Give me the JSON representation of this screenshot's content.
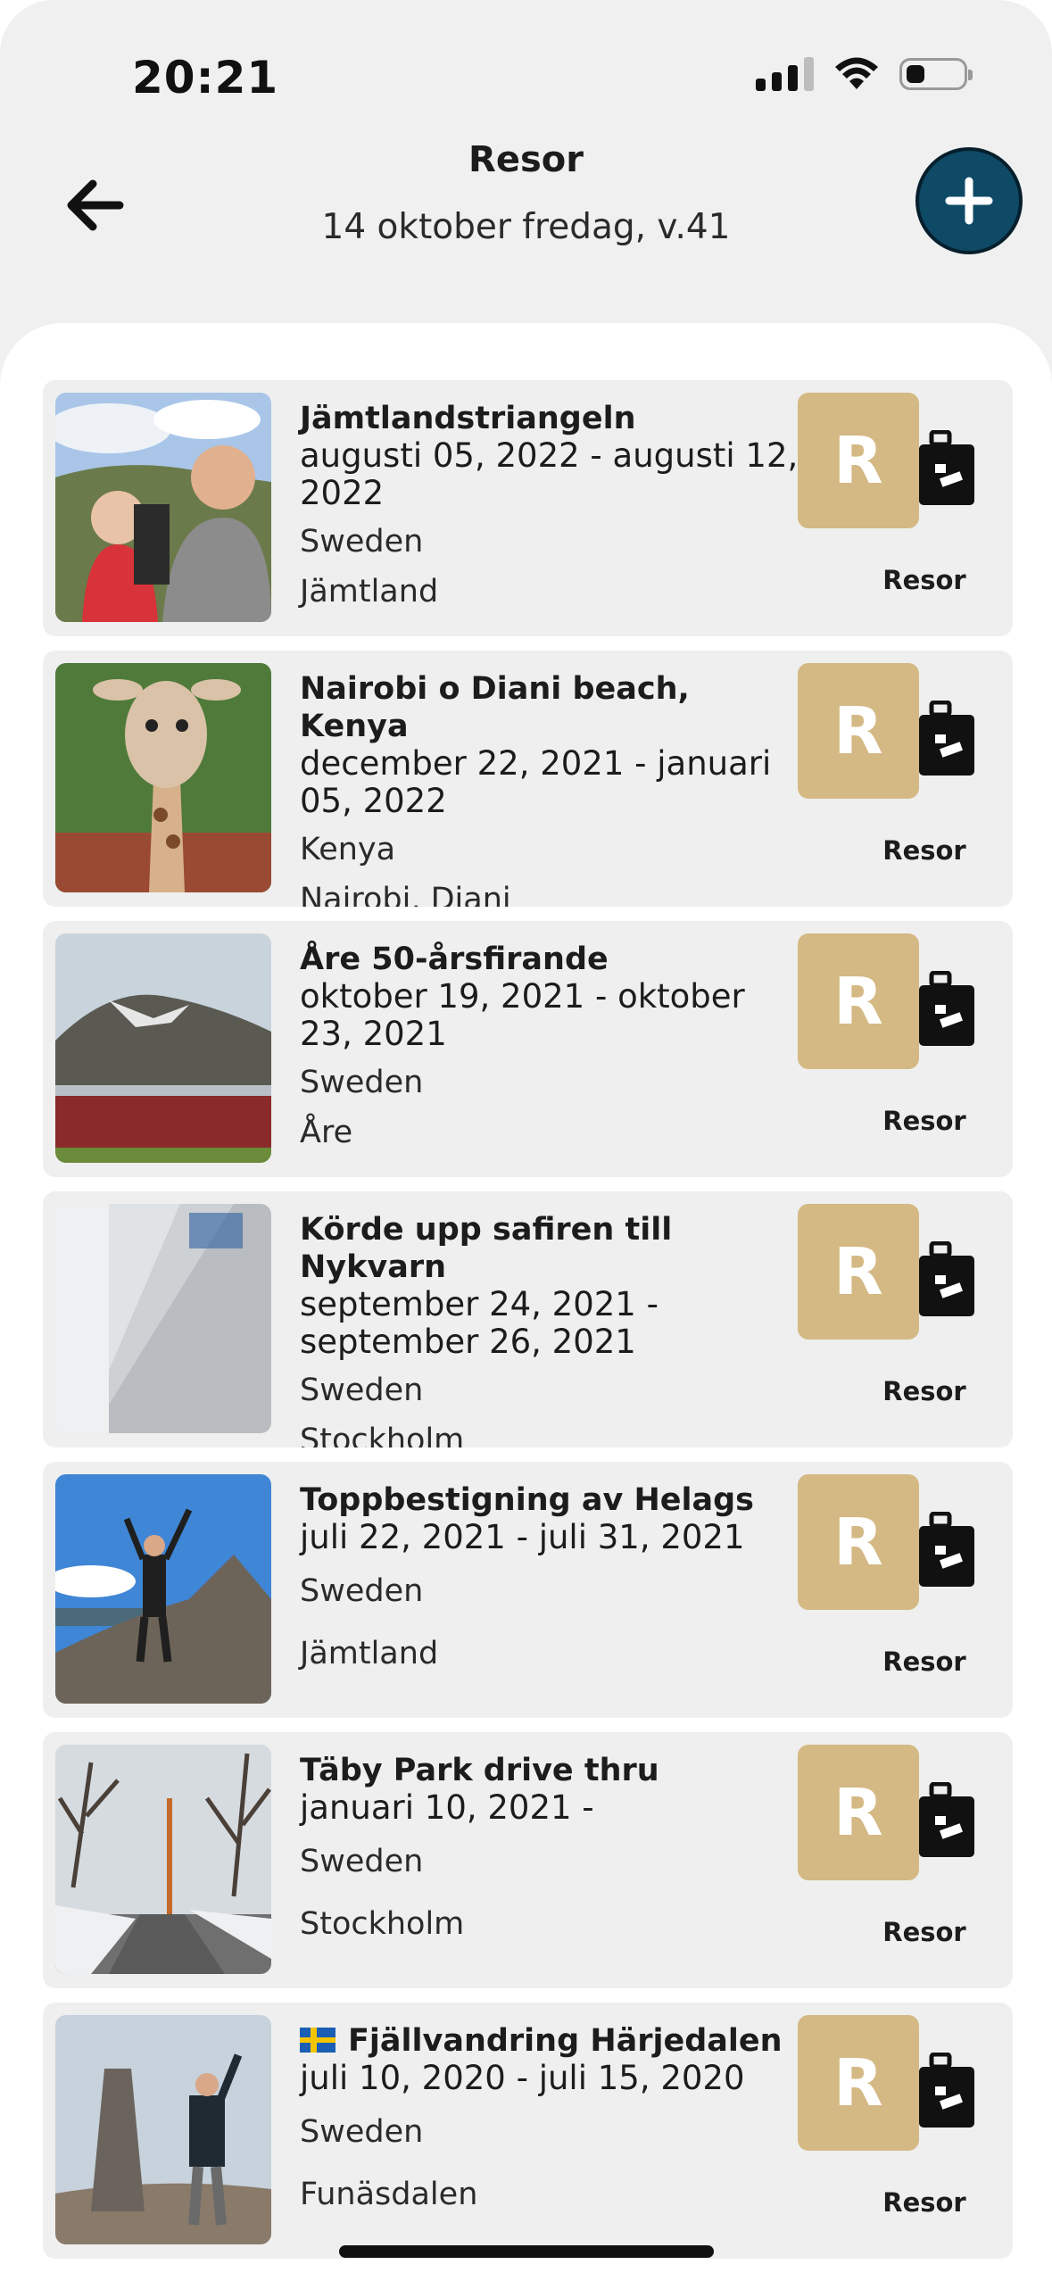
{
  "status_bar": {
    "time": "20:21"
  },
  "header": {
    "title": "Resor",
    "subtitle": "14 oktober fredag, v.41",
    "back_icon": "arrow-left-icon",
    "add_icon": "plus-icon"
  },
  "trips": [
    {
      "title": "Jämtlandstriangeln",
      "dates": "augusti 05, 2022 - augusti 12, 2022",
      "country": "Sweden",
      "region": "Jämtland",
      "badge": "R",
      "category": "Resor"
    },
    {
      "title": "Nairobi o Diani beach, Kenya",
      "dates": "december 22, 2021 - januari 05, 2022",
      "country": "Kenya",
      "region": "Nairobi, Diani",
      "badge": "R",
      "category": "Resor"
    },
    {
      "title": "Åre 50-årsfirande",
      "dates": "oktober 19, 2021 - oktober 23, 2021",
      "country": "Sweden",
      "region": "Åre",
      "badge": "R",
      "category": "Resor"
    },
    {
      "title": "Körde upp safiren till Nykvarn",
      "dates": "september 24, 2021 - september 26, 2021",
      "country": "Sweden",
      "region": "Stockholm",
      "badge": "R",
      "category": "Resor"
    },
    {
      "title": "Toppbestigning av Helags",
      "dates": "juli 22, 2021 - juli 31, 2021",
      "country": "Sweden",
      "region": "Jämtland",
      "badge": "R",
      "category": "Resor"
    },
    {
      "title": "Täby Park drive thru",
      "dates": "januari 10, 2021 -",
      "country": "Sweden",
      "region": "Stockholm",
      "badge": "R",
      "category": "Resor"
    },
    {
      "title": "Fjällvandring Härjedalen",
      "title_flag": "sweden-flag-icon",
      "dates": "juli 10, 2020 - juli 15, 2020",
      "country": "Sweden",
      "region": "Funäsdalen",
      "badge": "R",
      "category": "Resor"
    }
  ],
  "colors": {
    "badge_bg": "#d4b984",
    "add_button_bg": "#0e4a66",
    "card_bg": "#efefef",
    "screen_bg": "#f0f0f0"
  }
}
